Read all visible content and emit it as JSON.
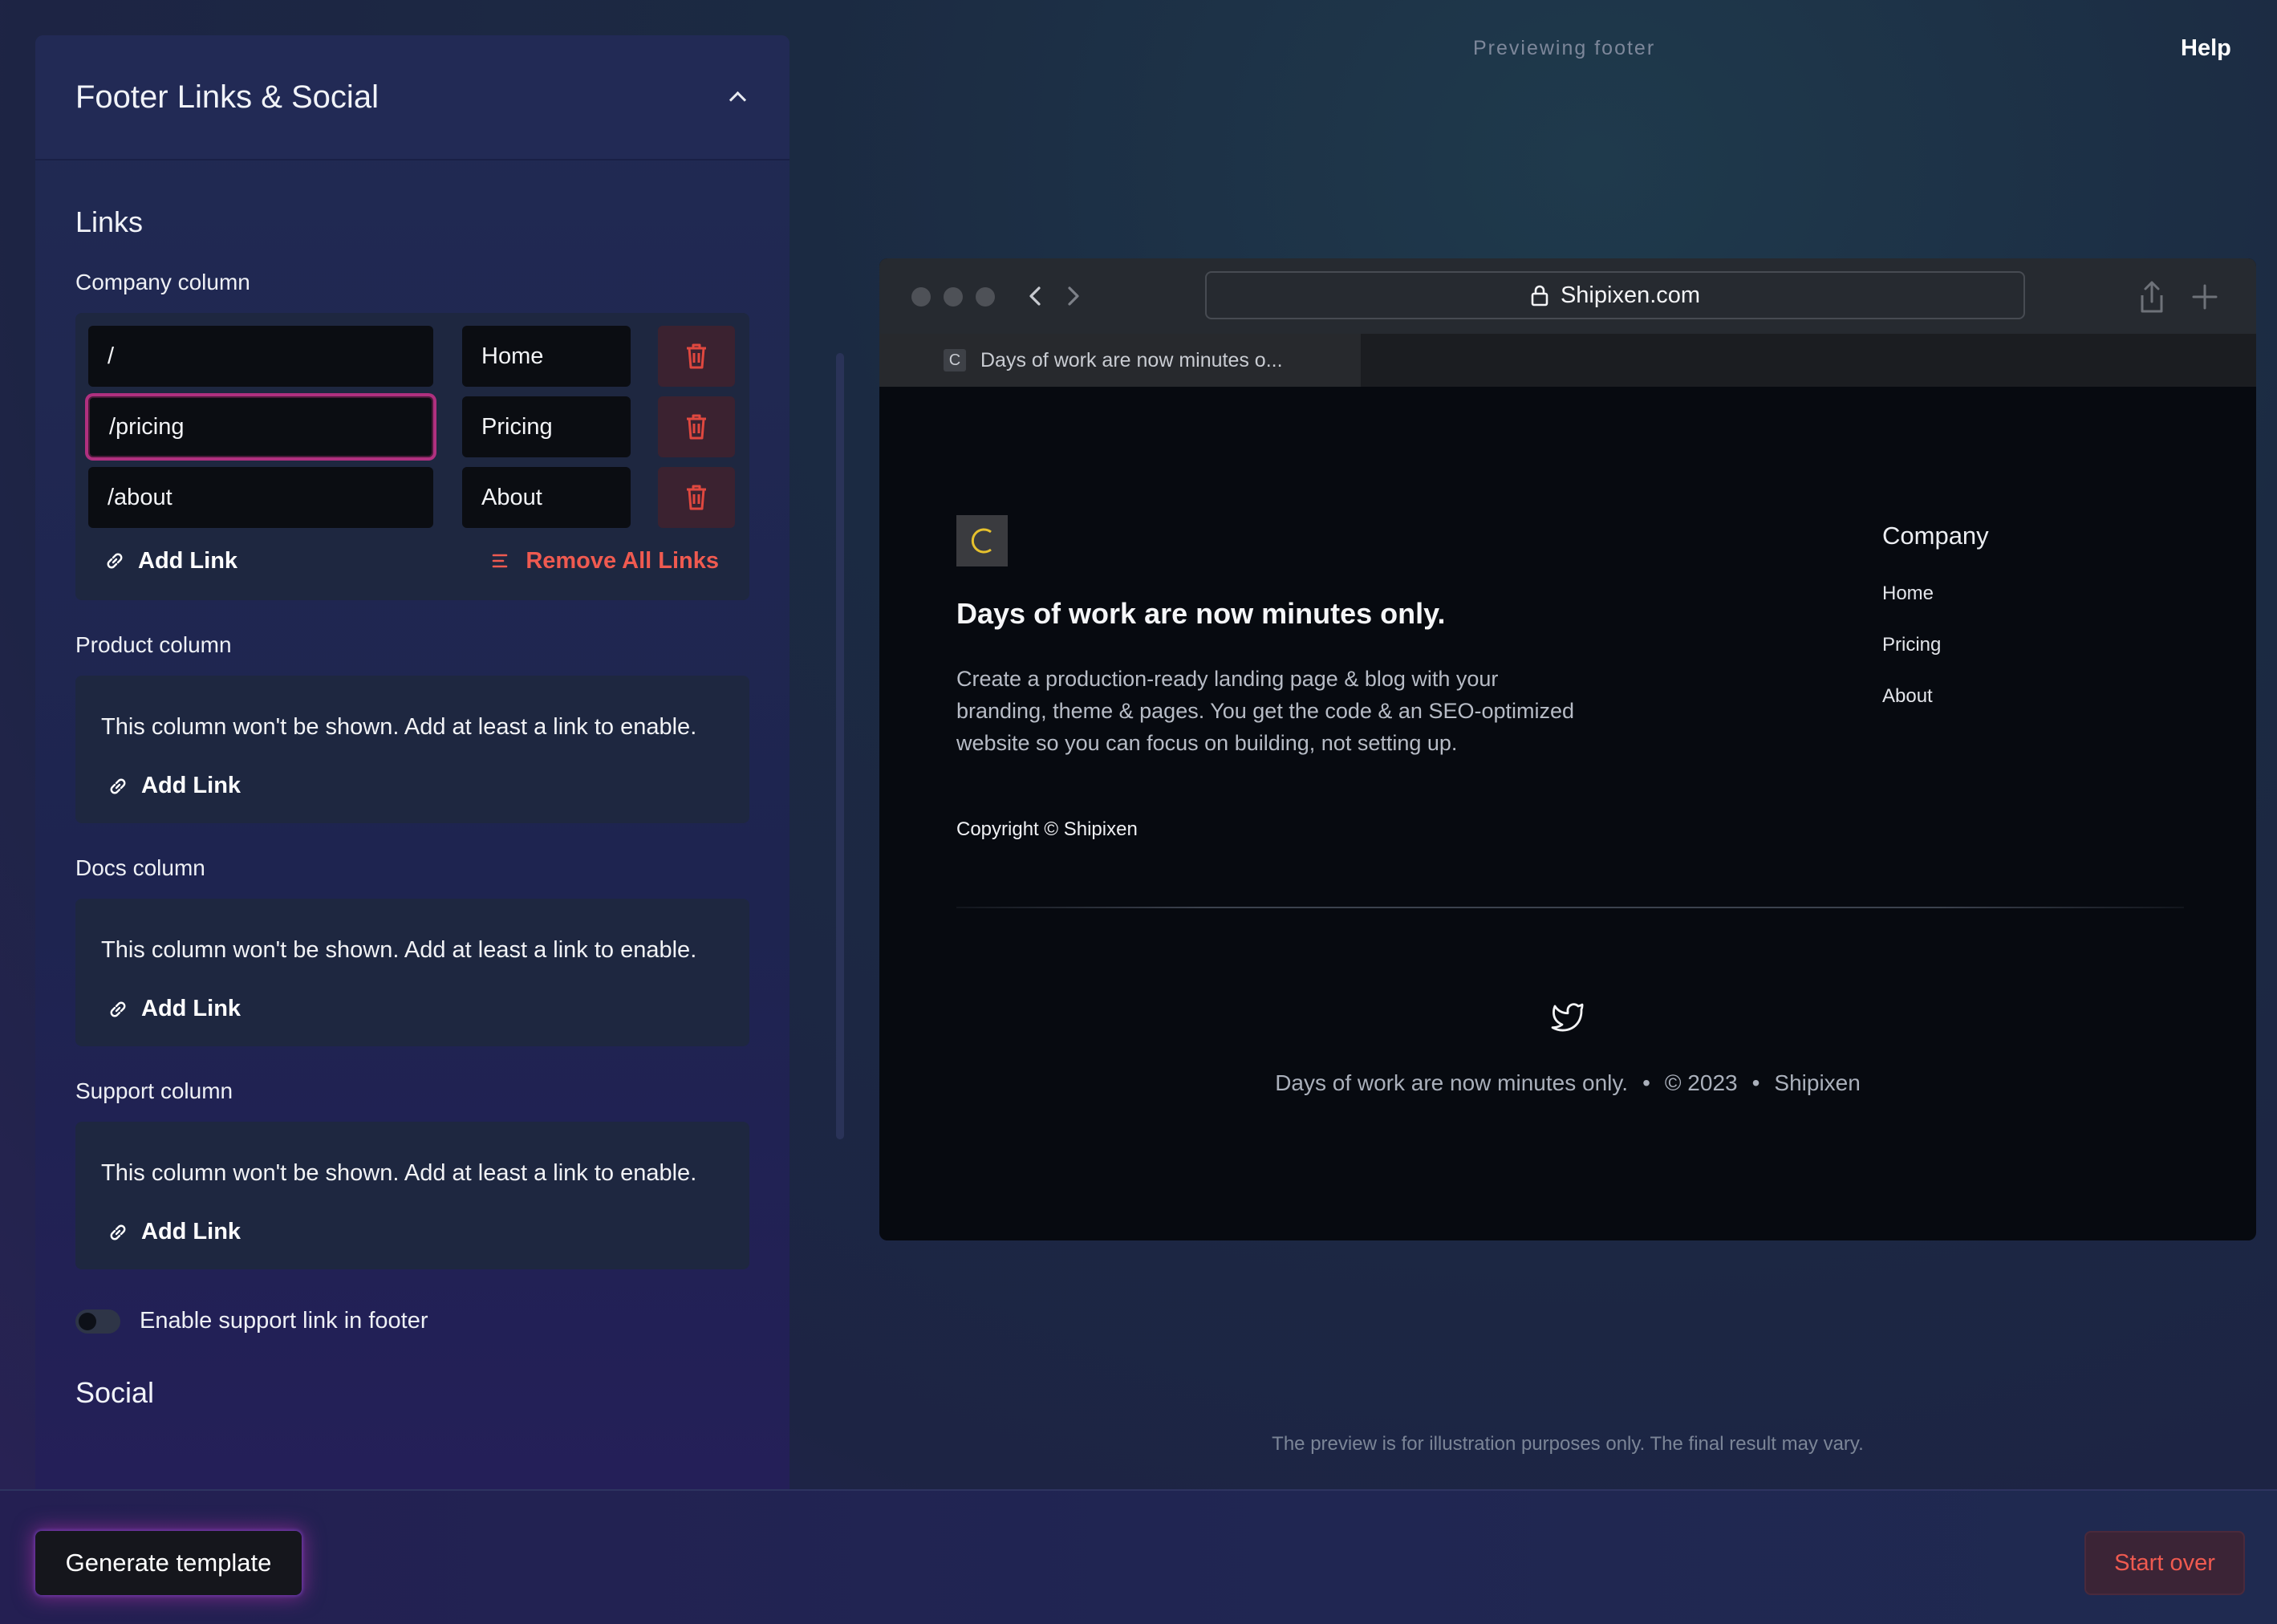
{
  "panel": {
    "title": "Footer Links & Social",
    "links_title": "Links",
    "company": {
      "label": "Company column",
      "rows": [
        {
          "url": "/",
          "label": "Home"
        },
        {
          "url": "/pricing",
          "label": "Pricing"
        },
        {
          "url": "/about",
          "label": "About"
        }
      ],
      "add_link": "Add Link",
      "remove_all": "Remove All Links"
    },
    "product": {
      "label": "Product column",
      "message": "This column won't be shown. Add at least a link to enable.",
      "add_link": "Add Link"
    },
    "docs": {
      "label": "Docs column",
      "message": "This column won't be shown. Add at least a link to enable.",
      "add_link": "Add Link"
    },
    "support": {
      "label": "Support column",
      "message": "This column won't be shown. Add at least a link to enable.",
      "add_link": "Add Link"
    },
    "toggle_label": "Enable support link in footer",
    "toggle_on": false,
    "social_title": "Social"
  },
  "header": {
    "preview_label": "Previewing footer",
    "help": "Help"
  },
  "browser": {
    "address": "Shipixen.com",
    "tab_favicon": "C",
    "tab_title": "Days of work are now minutes o..."
  },
  "site": {
    "logo_letter": "C",
    "heading": "Days of work are now minutes only.",
    "description": "Create a production-ready landing page & blog with your branding, theme & pages. You get the code & an SEO-optimized website so you can focus on building, not setting up.",
    "copyright": "Copyright © Shipixen",
    "column_title": "Company",
    "column_links": [
      "Home",
      "Pricing",
      "About"
    ],
    "bottom_tagline": "Days of work are now minutes only.",
    "bottom_sep": "•",
    "bottom_year": "© 2023",
    "bottom_brand": "Shipixen"
  },
  "disclaimer": "The preview is for illustration purposes only. The final result may vary.",
  "actions": {
    "generate": "Generate template",
    "start_over": "Start over"
  },
  "colors": {
    "accent_focus": "#b0307f",
    "danger": "#ef5a50",
    "logo_accent": "#e6c12d"
  },
  "icons": [
    "chevron-up-icon",
    "trash-icon",
    "link-icon",
    "remove-list-icon",
    "lock-icon",
    "share-icon",
    "plus-icon",
    "twitter-icon",
    "back-icon",
    "forward-icon"
  ]
}
